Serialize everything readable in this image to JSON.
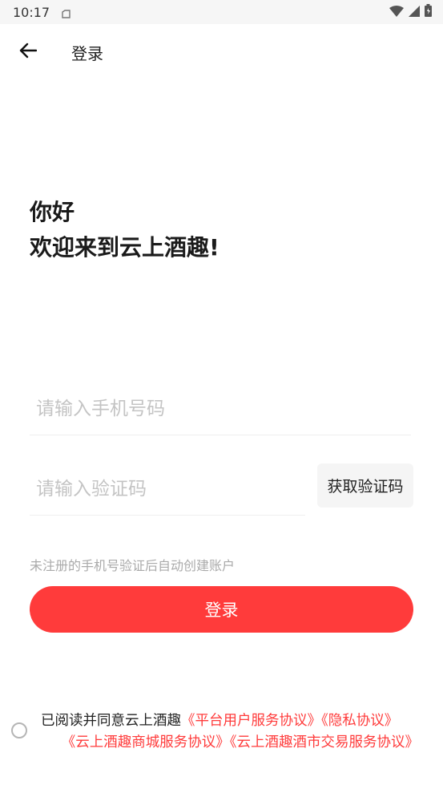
{
  "status_bar": {
    "time": "10:17",
    "icons": [
      "notification-icon",
      "wifi-icon",
      "signal-icon",
      "battery-icon"
    ]
  },
  "app_bar": {
    "back_icon": "arrow-left-icon",
    "title": "登录"
  },
  "greeting": {
    "line1": "你好",
    "line2": "欢迎来到云上酒趣!"
  },
  "form": {
    "phone_placeholder": "请输入手机号码",
    "phone_value": "",
    "code_placeholder": "请输入验证码",
    "code_value": "",
    "get_code_label": "获取验证码",
    "hint": "未注册的手机号验证后自动创建账户",
    "login_label": "登录"
  },
  "agreement": {
    "checked": false,
    "prefix": "已阅读并同意云上酒趣",
    "link1": "《平台用户服务协议》",
    "link2": "《隐私协议》",
    "link3": "《云上酒趣商城服务协议》",
    "link4": "《云上酒趣酒市交易服务协议》"
  },
  "colors": {
    "accent": "#ff3b3b",
    "placeholder": "#c4c4c4",
    "hint": "#aaaaaa"
  }
}
